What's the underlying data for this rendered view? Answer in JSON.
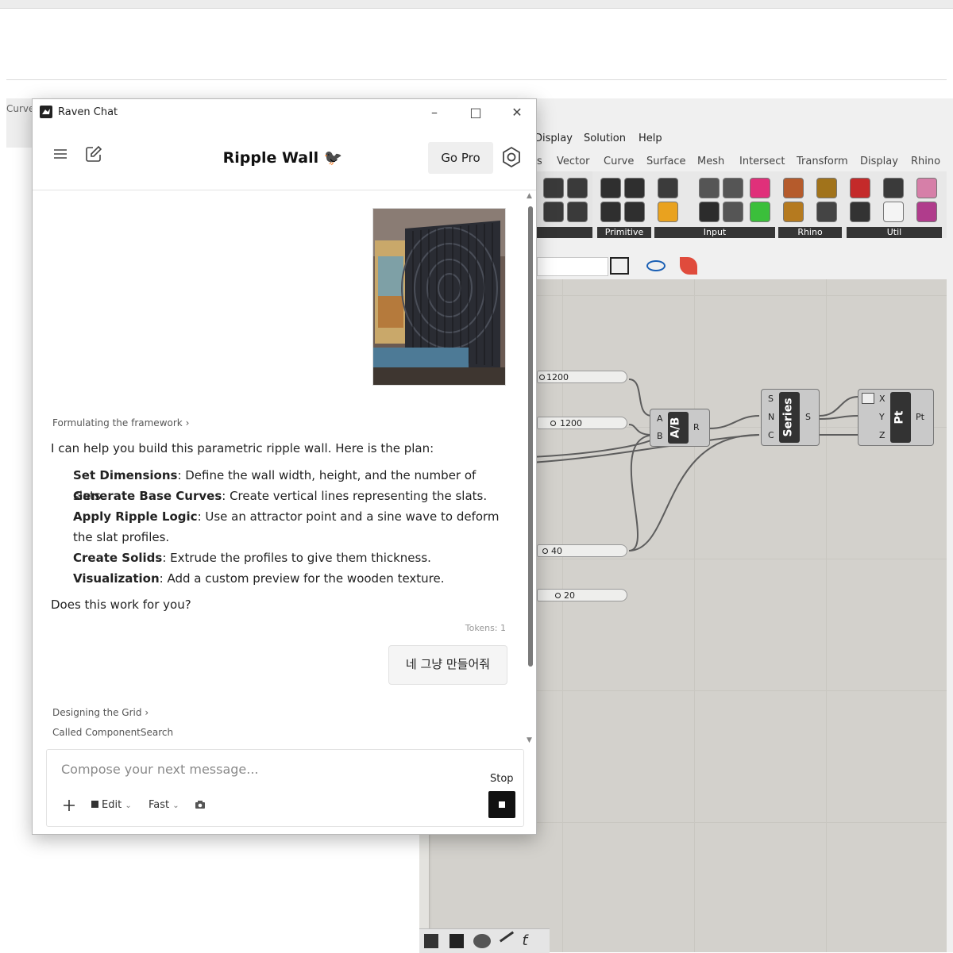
{
  "rhino": {
    "strip_label": "Curve"
  },
  "grasshopper": {
    "menu": [
      "Display",
      "Solution",
      "Help"
    ],
    "tabs": [
      "s",
      "Vector",
      "Curve",
      "Surface",
      "Mesh",
      "Intersect",
      "Transform",
      "Display",
      "Rhino"
    ],
    "ribbon_groups": [
      "Primitive",
      "Input",
      "Rhino",
      "Util"
    ],
    "sliders": [
      "1200",
      "1200",
      "40",
      "20"
    ],
    "components": {
      "ab": {
        "label": "A/B",
        "inputs": [
          "A",
          "B"
        ],
        "output": "R"
      },
      "series": {
        "label": "Series",
        "inputs": [
          "S",
          "N",
          "C"
        ],
        "output": "S"
      },
      "pt": {
        "label": "Pt",
        "inputs": [
          "X",
          "Y",
          "Z"
        ],
        "output": "Pt"
      }
    }
  },
  "raven": {
    "window_title": "Raven Chat",
    "chat_title": "Ripple Wall 🐦‍⬛",
    "go_pro": "Go Pro",
    "thinking_1": "Formulating the framework",
    "intro": "I can help you build this parametric ripple wall. Here is the plan:",
    "plan": [
      {
        "title": "Set Dimensions",
        "text": ": Define the wall width, height, and the number of slats."
      },
      {
        "title": "Generate Base Curves",
        "text": ": Create vertical lines representing the slats."
      },
      {
        "title": "Apply Ripple Logic",
        "text": ": Use an attractor point and a sine wave to deform the slat profiles."
      },
      {
        "title": "Create Solids",
        "text": ": Extrude the profiles to give them thickness."
      },
      {
        "title": "Visualization",
        "text": ": Add a custom preview for the wooden texture."
      }
    ],
    "question": "Does this work for you?",
    "tokens": "Tokens: 1",
    "user_message": "네 그냥 만들어줘",
    "thinking_2": "Designing the Grid",
    "tool_call": "Called ComponentSearch",
    "composer_placeholder": "Compose your next message...",
    "stop_label": "Stop",
    "mode": "Edit",
    "speed": "Fast",
    "arrow": "›",
    "chevron": "⌄",
    "icons": [
      "menu-icon",
      "new-chat-icon",
      "settings-icon",
      "plus-icon",
      "camera-icon",
      "stop-icon"
    ]
  }
}
